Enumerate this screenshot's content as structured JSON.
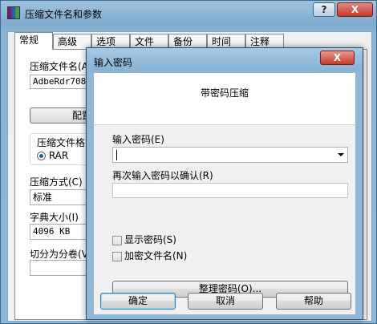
{
  "background_window": {
    "title": "压缩文件名和参数",
    "help_button": "?",
    "close_button": "X",
    "tabs": [
      "常规",
      "高级",
      "选项",
      "文件",
      "备份",
      "时间",
      "注释"
    ],
    "archive_name_label": "压缩文件名(A",
    "archive_name_value": "AdbeRdr708_z",
    "configure_button": "配置",
    "format_label": "压缩文件格式",
    "format_rar": "RAR",
    "method_label": "压缩方式(C)",
    "method_value": "标准",
    "dict_label": "字典大小(I)",
    "dict_value": "4096 KB",
    "split_label": "切分为分卷(V"
  },
  "dialog": {
    "title": "输入密码",
    "close_button": "X",
    "header": "带密码压缩",
    "enter_password_label": "输入密码(E)",
    "reenter_password_label": "再次输入密码以确认(R)",
    "show_password_label": "显示密码(S)",
    "encrypt_filenames_label": "加密文件名(N)",
    "organize_button": "整理密码(O)...",
    "ok_button": "确定",
    "cancel_button": "取消",
    "help_button": "帮助"
  }
}
